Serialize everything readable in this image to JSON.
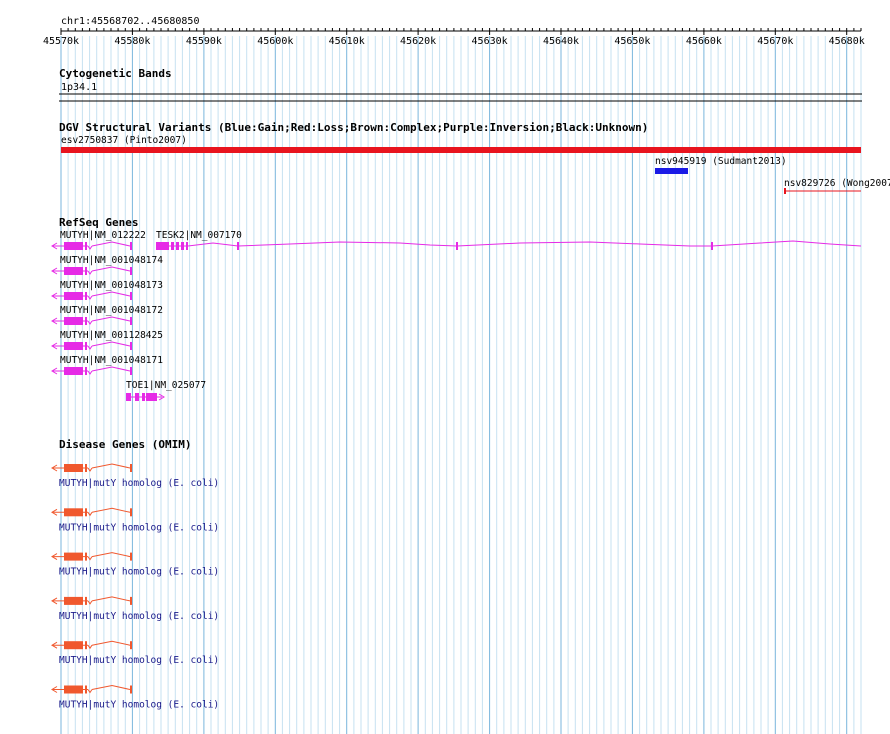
{
  "ruler": {
    "region": "chr1:45568702..45680850",
    "ticks": [
      "45570k",
      "45580k",
      "45590k",
      "45600k",
      "45610k",
      "45620k",
      "45630k",
      "45640k",
      "45650k",
      "45660k",
      "45670k",
      "45680k"
    ]
  },
  "cytoband": {
    "title": "Cytogenetic Bands",
    "band": "1p34.1"
  },
  "dgv": {
    "title": "DGV Structural Variants (Blue:Gain;Red:Loss;Brown:Complex;Purple:Inversion;Black:Unknown)",
    "variants": [
      {
        "label": "esv2750837 (Pinto2007)",
        "color": "#e8141e"
      },
      {
        "label": "nsv945919 (Sudmant2013)",
        "color": "#1a1ae6"
      },
      {
        "label": "nsv829726 (Wong2007)",
        "color": "#e8141e"
      }
    ]
  },
  "refseq": {
    "title": "RefSeq Genes",
    "color": "#e62ae6",
    "transcripts": [
      {
        "label": "MUTYH|NM_012222"
      },
      {
        "label": "TESK2|NM_007170"
      },
      {
        "label": "MUTYH|NM_001048174"
      },
      {
        "label": "MUTYH|NM_001048173"
      },
      {
        "label": "MUTYH|NM_001048172"
      },
      {
        "label": "MUTYH|NM_001128425"
      },
      {
        "label": "MUTYH|NM_001048171"
      },
      {
        "label": "TOE1|NM_025077"
      }
    ]
  },
  "omim": {
    "title": "Disease Genes (OMIM)",
    "color": "#f0582e",
    "label_color": "#1a1a8a",
    "genes": [
      {
        "label": "MUTYH|mutY homolog (E. coli)"
      },
      {
        "label": "MUTYH|mutY homolog (E. coli)"
      },
      {
        "label": "MUTYH|mutY homolog (E. coli)"
      },
      {
        "label": "MUTYH|mutY homolog (E. coli)"
      },
      {
        "label": "MUTYH|mutY homolog (E. coli)"
      },
      {
        "label": "MUTYH|mutY homolog (E. coli)"
      }
    ]
  }
}
